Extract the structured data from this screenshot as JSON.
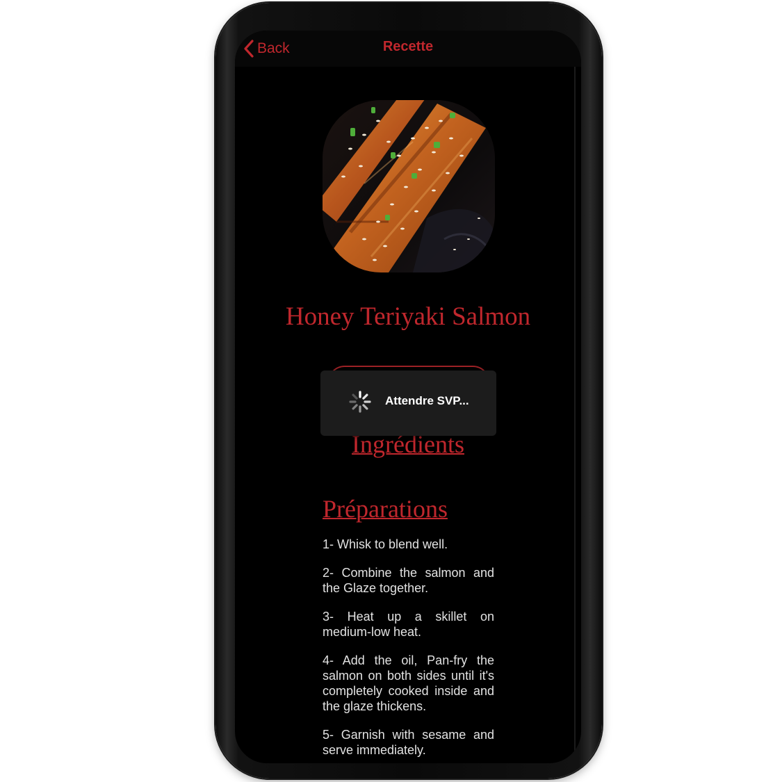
{
  "navbar": {
    "back_label": "Back",
    "title": "Recette"
  },
  "recipe": {
    "title": "Honey Teriyaki Salmon",
    "image_name": "honey-teriyaki-salmon-photo"
  },
  "sections": {
    "ingredients_label": "Ingrédients",
    "preparations_label": "Préparations"
  },
  "steps": [
    "1- Whisk to blend well.",
    "2- Combine the salmon and the Glaze together.",
    "3- Heat up a skillet on medium-low heat.",
    "4- Add the oil, Pan-fry the salmon on both sides until it's completely cooked inside and the glaze thickens.",
    "5- Garnish with sesame and serve immediately."
  ],
  "loading": {
    "text": "Attendre SVP..."
  },
  "colors": {
    "accent": "#c0272d",
    "background": "#000000",
    "text": "#e2e2e2"
  },
  "icons": {
    "back": "chevron-left-icon",
    "loading": "spinner-icon"
  }
}
